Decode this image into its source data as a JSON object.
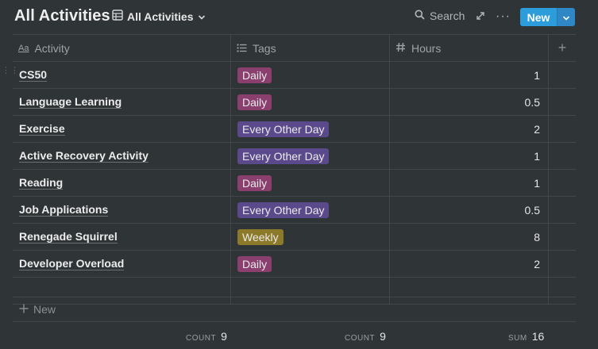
{
  "header": {
    "title": "All Activities",
    "view_label": "All Activities",
    "search_label": "Search",
    "more_label": "···",
    "new_label": "New"
  },
  "columns": [
    {
      "label": "Activity",
      "icon": "title-text-icon"
    },
    {
      "label": "Tags",
      "icon": "list-icon"
    },
    {
      "label": "Hours",
      "icon": "hash-icon"
    }
  ],
  "add_column_label": "+",
  "rows": [
    {
      "activity": "CS50",
      "tag": "Daily",
      "tag_color": "#8a3f6f",
      "hours": "1"
    },
    {
      "activity": "Language Learning",
      "tag": "Daily",
      "tag_color": "#8a3f6f",
      "hours": "0.5"
    },
    {
      "activity": "Exercise",
      "tag": "Every Other Day",
      "tag_color": "#5b4a8b",
      "hours": "2"
    },
    {
      "activity": "Active Recovery Activity",
      "tag": "Every Other Day",
      "tag_color": "#5b4a8b",
      "hours": "1"
    },
    {
      "activity": "Reading",
      "tag": "Daily",
      "tag_color": "#8a3f6f",
      "hours": "1"
    },
    {
      "activity": "Job Applications",
      "tag": "Every Other Day",
      "tag_color": "#5b4a8b",
      "hours": "0.5"
    },
    {
      "activity": "Renegade Squirrel",
      "tag": "Weekly",
      "tag_color": "#8c7a2a",
      "hours": "8"
    },
    {
      "activity": "Developer Overload",
      "tag": "Daily",
      "tag_color": "#8a3f6f",
      "hours": "2"
    }
  ],
  "new_row_label": "New",
  "footer": {
    "activity": {
      "label": "COUNT",
      "value": "9"
    },
    "tags": {
      "label": "COUNT",
      "value": "9"
    },
    "hours": {
      "label": "SUM",
      "value": "16"
    }
  }
}
